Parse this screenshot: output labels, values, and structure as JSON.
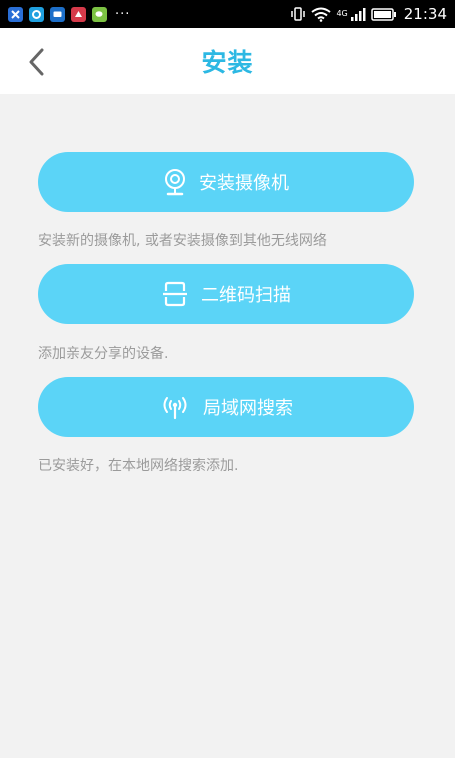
{
  "status_bar": {
    "app_icons": [
      "x-app-icon",
      "c-app-icon",
      "message-app-icon",
      "game-app-icon",
      "wechat-app-icon"
    ],
    "more": "···",
    "network": "4G",
    "time": "21:34"
  },
  "header": {
    "title": "安装"
  },
  "actions": [
    {
      "label": "安装摄像机",
      "icon": "camera-icon",
      "hint": "安装新的摄像机, 或者安装摄像到其他无线网络"
    },
    {
      "label": "二维码扫描",
      "icon": "scan-icon",
      "hint": "添加亲友分享的设备."
    },
    {
      "label": "局域网搜索",
      "icon": "wireless-icon",
      "hint": "已安装好，在本地网络搜索添加."
    }
  ],
  "colors": {
    "accent": "#2cb8e3",
    "button": "#5bd4f7",
    "background": "#f2f2f2",
    "hint_text": "#9b9b9b"
  }
}
